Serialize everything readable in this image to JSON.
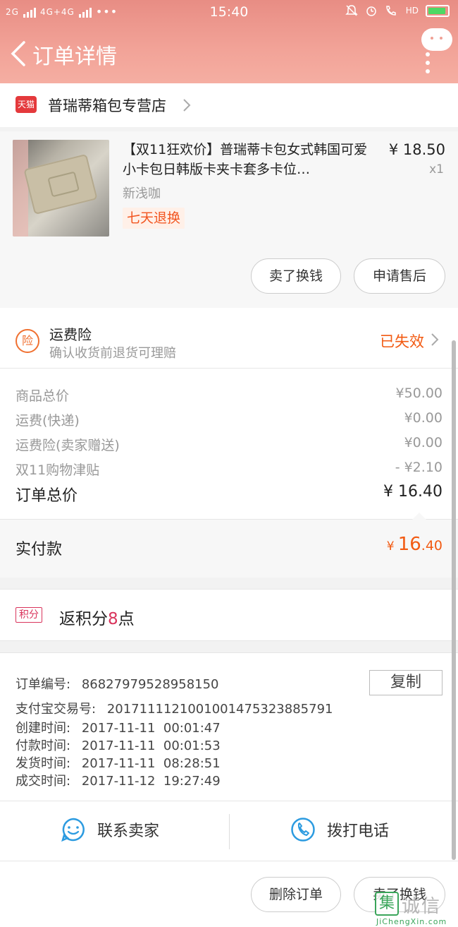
{
  "status_bar": {
    "network_left": "2G",
    "network_mid": "4G+4G",
    "more": "•••",
    "time": "15:40",
    "hd": "HD"
  },
  "header": {
    "title": "订单详情"
  },
  "store": {
    "badge": "天猫",
    "name": "普瑞蒂箱包专营店"
  },
  "product": {
    "title": "【双11狂欢价】普瑞蒂卡包女式韩国可爱小卡包日韩版卡夹卡套多卡位…",
    "price": "¥ 18.50",
    "qty": "x1",
    "sku": "新浅咖",
    "tag": "七天退换",
    "sell_btn": "卖了换钱",
    "aftersale_btn": "申请售后"
  },
  "insurance": {
    "icon_text": "险",
    "title": "运费险",
    "subtitle": "确认收货前退货可理赔",
    "status": "已失效"
  },
  "prices": {
    "rows": [
      {
        "label": "商品总价",
        "value": "¥50.00"
      },
      {
        "label": "运费(快递)",
        "value": "¥0.00"
      },
      {
        "label": "运费险(卖家赠送)",
        "value": "¥0.00"
      },
      {
        "label": "双11购物津贴",
        "value": "- ¥2.10"
      }
    ],
    "total_label": "订单总价",
    "total_value": "¥ 16.40"
  },
  "paid": {
    "label": "实付款",
    "currency": "¥",
    "int": "16",
    "dec": ".40"
  },
  "points": {
    "badge": "积分",
    "prefix": "返积分",
    "num": "8",
    "suffix": "点"
  },
  "order_info": {
    "rows": [
      {
        "label": "订单编号:",
        "value": "86827979528958150"
      },
      {
        "label": "支付宝交易号:",
        "value": "2017111121001001475323885791"
      },
      {
        "label": "创建时间:",
        "value": "2017-11-11  00:01:47"
      },
      {
        "label": "付款时间:",
        "value": "2017-11-11  00:01:53"
      },
      {
        "label": "发货时间:",
        "value": "2017-11-11  08:28:51"
      },
      {
        "label": "成交时间:",
        "value": "2017-11-12  19:27:49"
      }
    ],
    "copy_btn": "复制"
  },
  "contact": {
    "seller": "联系卖家",
    "phone": "拨打电话"
  },
  "footer": {
    "delete_btn": "删除订单",
    "sell_btn": "卖了换钱"
  },
  "watermark": {
    "logo": "集",
    "cn": "诚信",
    "url": "JiChengXin.com"
  },
  "colors": {
    "header_start": "#e88d84",
    "header_end": "#f5aea2",
    "accent_orange": "#f25a12",
    "points_red": "#d9345c",
    "contact_blue": "#2c9be0"
  }
}
